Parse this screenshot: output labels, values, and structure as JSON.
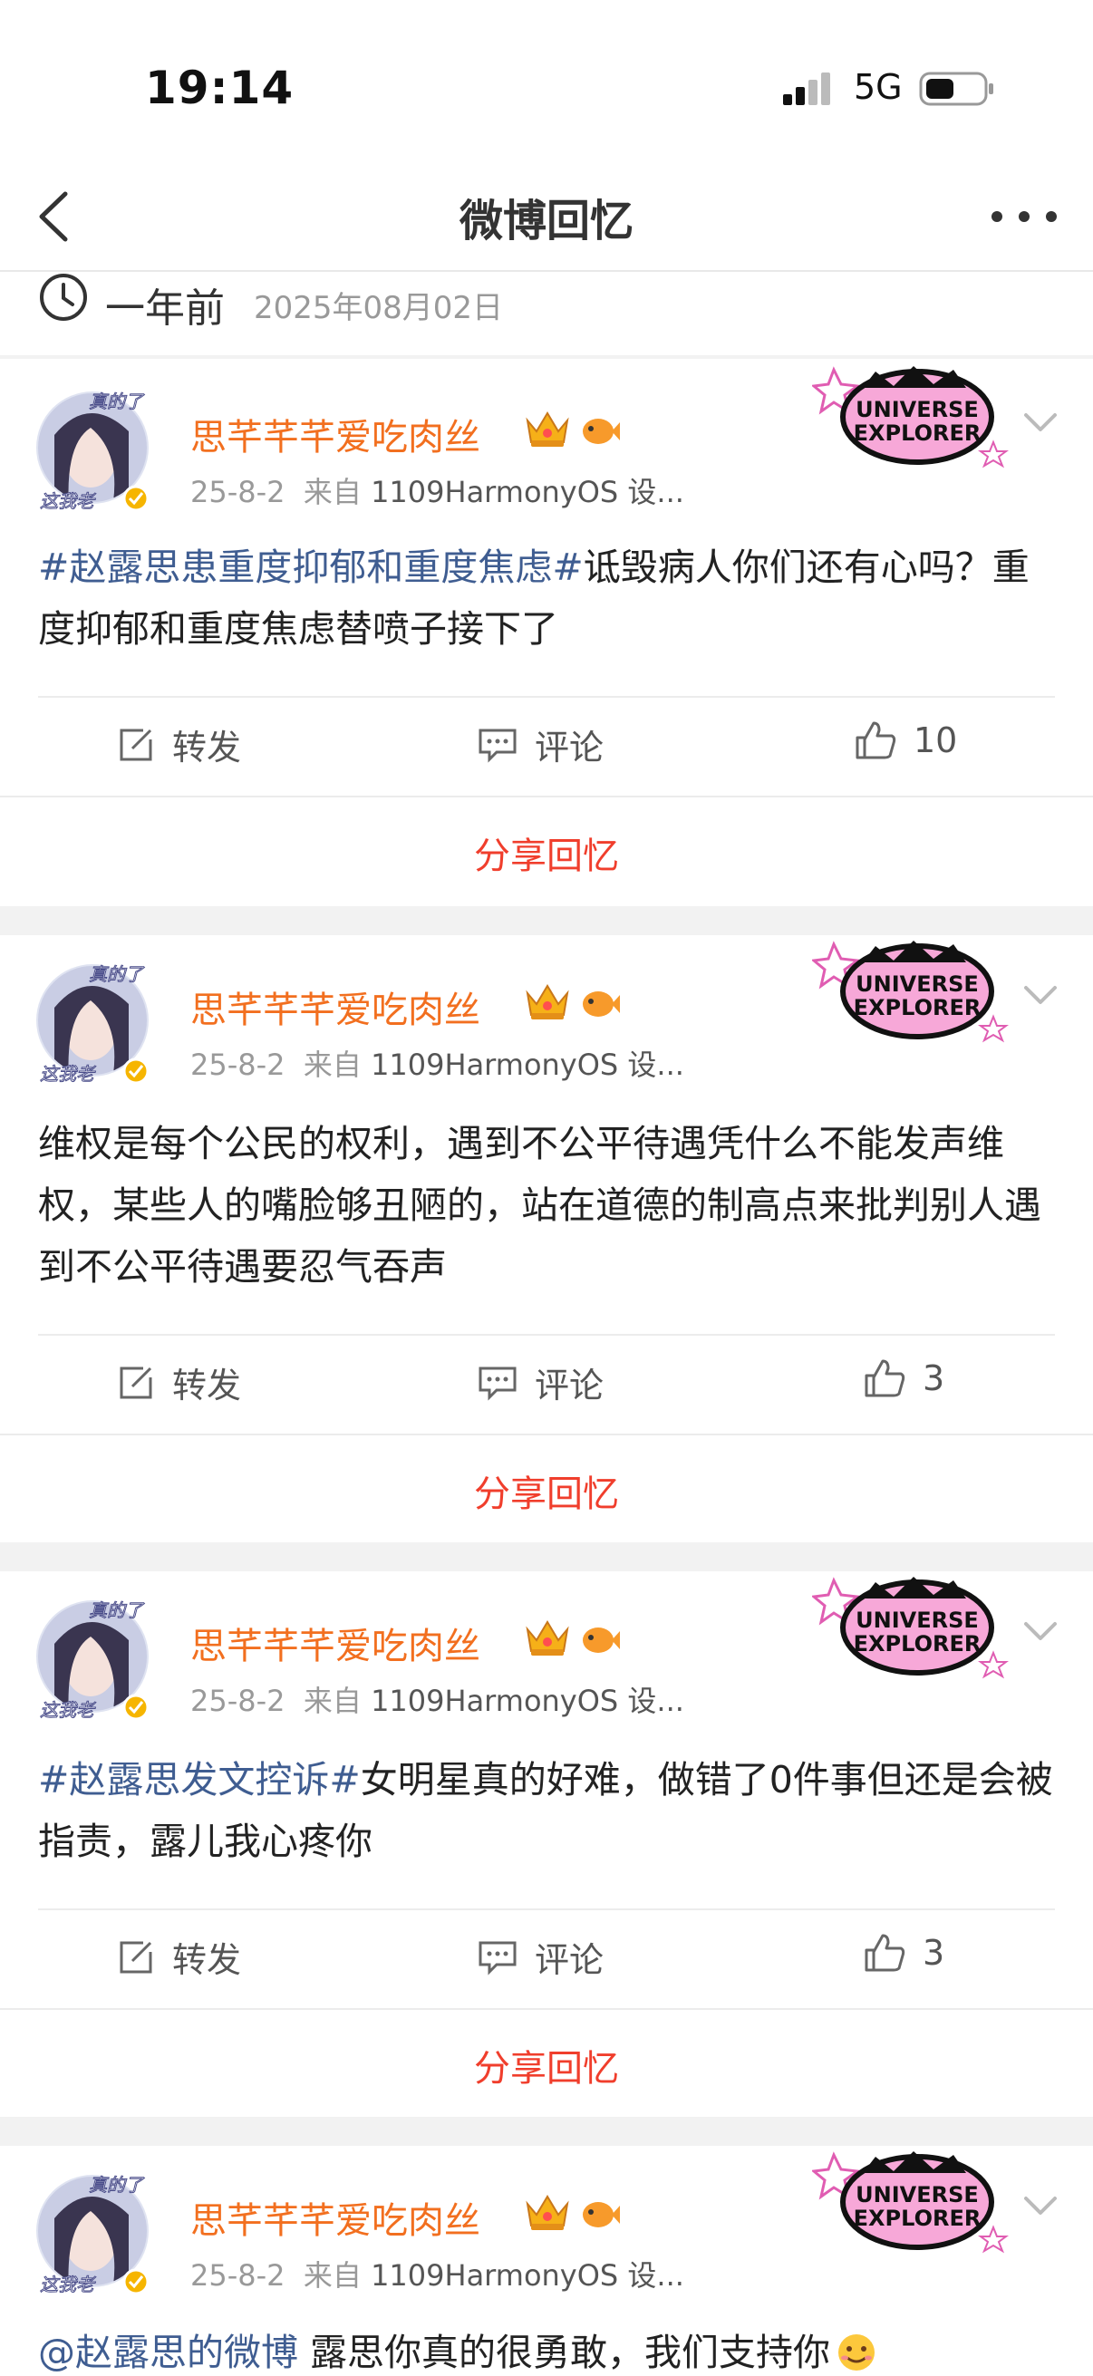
{
  "status": {
    "time": "19:14",
    "network": "5G"
  },
  "nav": {
    "title": "微博回忆"
  },
  "memory": {
    "ago": "一年前",
    "date": "2025年08月02日"
  },
  "badge_text": "UNIVERSE EXPLORER",
  "avatar_text": "真的了 这我老",
  "posts": [
    {
      "user": "思芊芊芊爱吃肉丝",
      "time": "25-8-2",
      "from": "来自",
      "source": "1109HarmonyOS 设...",
      "tag": "#赵露思患重度抑郁和重度焦虑#",
      "text": "诋毁病人你们还有心吗？重度抑郁和重度焦虑替喷子接下了",
      "repost": "转发",
      "comment": "评论",
      "likes": "10",
      "share": "分享回忆"
    },
    {
      "user": "思芊芊芊爱吃肉丝",
      "time": "25-8-2",
      "from": "来自",
      "source": "1109HarmonyOS 设...",
      "tag": "",
      "text": "维权是每个公民的权利，遇到不公平待遇凭什么不能发声维权，某些人的嘴脸够丑陋的，站在道德的制高点来批判别人遇到不公平待遇要忍气吞声",
      "repost": "转发",
      "comment": "评论",
      "likes": "3",
      "share": "分享回忆"
    },
    {
      "user": "思芊芊芊爱吃肉丝",
      "time": "25-8-2",
      "from": "来自",
      "source": "1109HarmonyOS 设...",
      "tag": "#赵露思发文控诉#",
      "text": "女明星真的好难，做错了0件事但还是会被指责，露儿我心疼你",
      "repost": "转发",
      "comment": "评论",
      "likes": "3",
      "share": "分享回忆"
    },
    {
      "user": "思芊芊芊爱吃肉丝",
      "time": "25-8-2",
      "from": "来自",
      "source": "1109HarmonyOS 设...",
      "tag": "@赵露思的微博",
      "text": " 露思你真的很勇敢，我们支持你"
    }
  ]
}
